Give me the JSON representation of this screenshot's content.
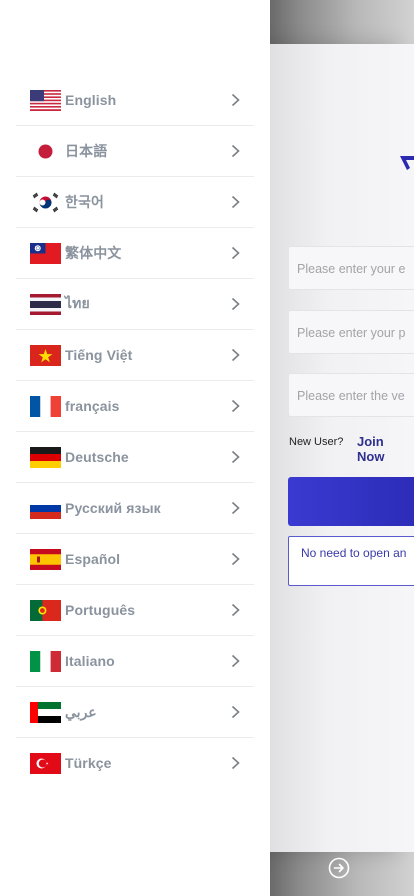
{
  "languages": [
    {
      "label": "English",
      "flag": "us-flag-icon"
    },
    {
      "label": "日本語",
      "flag": "japan-flag-icon"
    },
    {
      "label": "한국어",
      "flag": "korea-flag-icon"
    },
    {
      "label": "繁体中文",
      "flag": "taiwan-flag-icon"
    },
    {
      "label": "ไทย",
      "flag": "thailand-flag-icon"
    },
    {
      "label": "Tiếng Việt",
      "flag": "vietnam-flag-icon"
    },
    {
      "label": "français",
      "flag": "france-flag-icon"
    },
    {
      "label": "Deutsche",
      "flag": "germany-flag-icon"
    },
    {
      "label": "Русский язык",
      "flag": "russia-flag-icon"
    },
    {
      "label": "Español",
      "flag": "spain-flag-icon"
    },
    {
      "label": "Português",
      "flag": "portugal-flag-icon"
    },
    {
      "label": "Italiano",
      "flag": "italy-flag-icon"
    },
    {
      "label": "عربي",
      "flag": "uae-flag-icon"
    },
    {
      "label": "Türkçe",
      "flag": "turkey-flag-icon"
    }
  ],
  "login": {
    "account_placeholder": "Please enter your e",
    "password_placeholder": "Please enter your p",
    "code_placeholder": "Please enter the ve",
    "new_user_label": "New User?",
    "join_now_label": "Join Now",
    "notice_text": "No need to open an"
  },
  "colors": {
    "accent": "#2f2fb8",
    "language_text": "#8a939e"
  }
}
